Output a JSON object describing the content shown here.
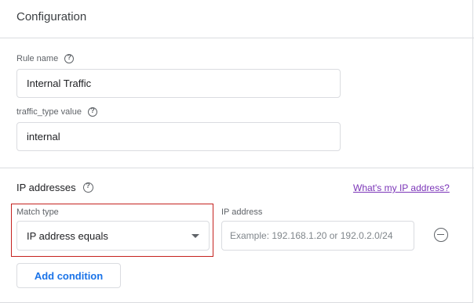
{
  "header": {
    "title": "Configuration"
  },
  "rule_name": {
    "label": "Rule name",
    "value": "Internal Traffic"
  },
  "traffic_type": {
    "label": "traffic_type value",
    "value": "internal"
  },
  "ip_section": {
    "title": "IP addresses",
    "link": "What's my IP address?",
    "match_type": {
      "label": "Match type",
      "selected": "IP address equals"
    },
    "ip_address": {
      "label": "IP address",
      "value": "",
      "placeholder": "Example: 192.168.1.20 or 192.0.2.0/24"
    },
    "add_condition": "Add condition"
  },
  "colors": {
    "highlight_border": "#c5221f",
    "link": "#7b35b8",
    "button_text": "#1a73e8"
  }
}
